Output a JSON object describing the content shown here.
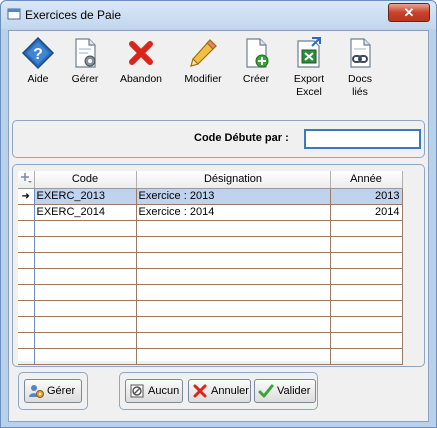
{
  "window": {
    "title": "Exercices de Paie",
    "close_label": "✕"
  },
  "toolbar": {
    "items": [
      {
        "name": "aide",
        "label": "Aide",
        "icon": "help-diamond-icon"
      },
      {
        "name": "gerer",
        "label": "Gérer",
        "icon": "document-gear-icon"
      },
      {
        "name": "abandon",
        "label": "Abandon",
        "icon": "red-x-icon"
      },
      {
        "name": "modifier",
        "label": "Modifier",
        "icon": "pencil-icon"
      },
      {
        "name": "creer",
        "label": "Créer",
        "icon": "document-add-icon"
      },
      {
        "name": "export-excel",
        "label": "Export\nExcel",
        "icon": "excel-export-icon"
      },
      {
        "name": "docs-lies",
        "label": "Docs\nliés",
        "icon": "document-link-icon"
      }
    ]
  },
  "filter": {
    "label": "Code Débute par :",
    "value": ""
  },
  "grid": {
    "columns": [
      "",
      "Code",
      "Désignation",
      "Année"
    ],
    "rows": [
      {
        "indicator": "➜",
        "code": "EXERC_2013",
        "designation": "Exercice : 2013",
        "annee": "2013"
      },
      {
        "indicator": "",
        "code": "EXERC_2014",
        "designation": "Exercice : 2014",
        "annee": "2014"
      }
    ]
  },
  "buttons": {
    "gerer": "Gérer",
    "aucun": "Aucun",
    "annuler": "Annuler",
    "valider": "Valider"
  },
  "colors": {
    "selection": "#bfd3ee",
    "title_bar": "#c2d6ee",
    "close": "#c7432a"
  }
}
